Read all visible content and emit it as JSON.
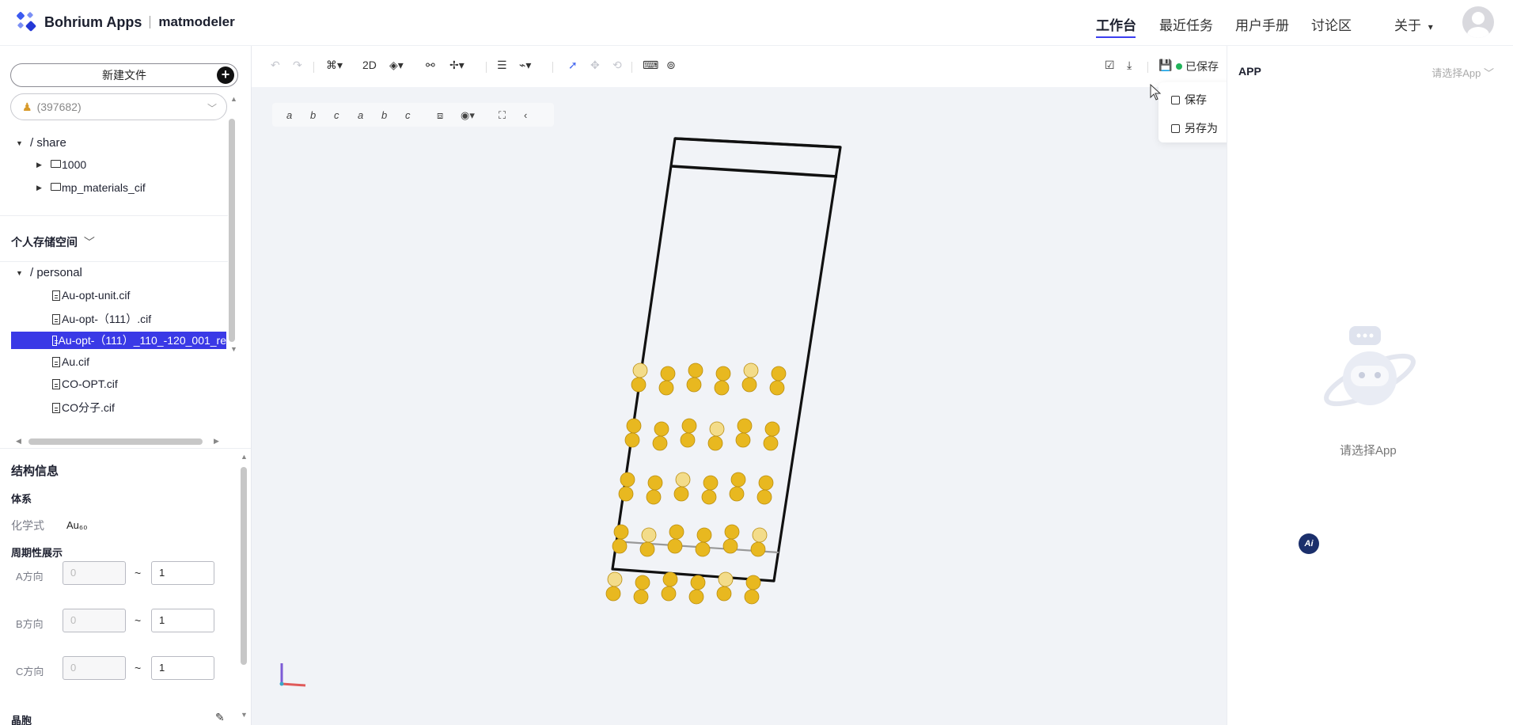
{
  "header": {
    "brand": "Bohrium Apps",
    "product": "matmodeler",
    "nav": [
      {
        "label": "工作台",
        "active": true
      },
      {
        "label": "最近任务",
        "active": false
      },
      {
        "label": "用户手册",
        "active": false
      },
      {
        "label": "讨论区",
        "active": false
      },
      {
        "label": "关于",
        "active": false
      }
    ],
    "about_chevron": "⌄"
  },
  "sidebar": {
    "new_file_label": "新建文件",
    "project": "(397682)",
    "share_root": "/ share",
    "share_items": [
      "1000",
      "mp_materials_cif"
    ],
    "personal_section": "个人存储空间",
    "personal_root": "/ personal",
    "personal_files": [
      "Au-opt-unit.cif",
      "Au-opt-（111）.cif",
      "Au-opt-（111）_110_-120_001_re",
      "Au.cif",
      "CO-OPT.cif",
      "CO分子.cif"
    ],
    "selected_file_index": 2
  },
  "structure_info": {
    "title": "结构信息",
    "system_label": "体系",
    "formula_label": "化学式",
    "formula_value": "Au₆₀",
    "periodic_label": "周期性展示",
    "directions": [
      {
        "label": "A方向",
        "min": "0",
        "max": "1"
      },
      {
        "label": "B方向",
        "min": "0",
        "max": "1"
      },
      {
        "label": "C方向",
        "min": "0",
        "max": "1"
      }
    ],
    "cell_label": "晶胞"
  },
  "toolbar": {
    "mode_2d": "2D",
    "saved_label": "已保存",
    "saved_color": "#21b35a",
    "save_menu": [
      {
        "label": "保存"
      },
      {
        "label": "另存为"
      }
    ],
    "axis_buttons": [
      "a",
      "b",
      "c",
      "a",
      "b",
      "c"
    ]
  },
  "viewer": {
    "atom_color": "#e8b820",
    "atom_count": 60
  },
  "right_panel": {
    "title": "APP",
    "select_placeholder": "请选择App",
    "empty_text": "请选择App",
    "ai_badge": "Ai"
  }
}
